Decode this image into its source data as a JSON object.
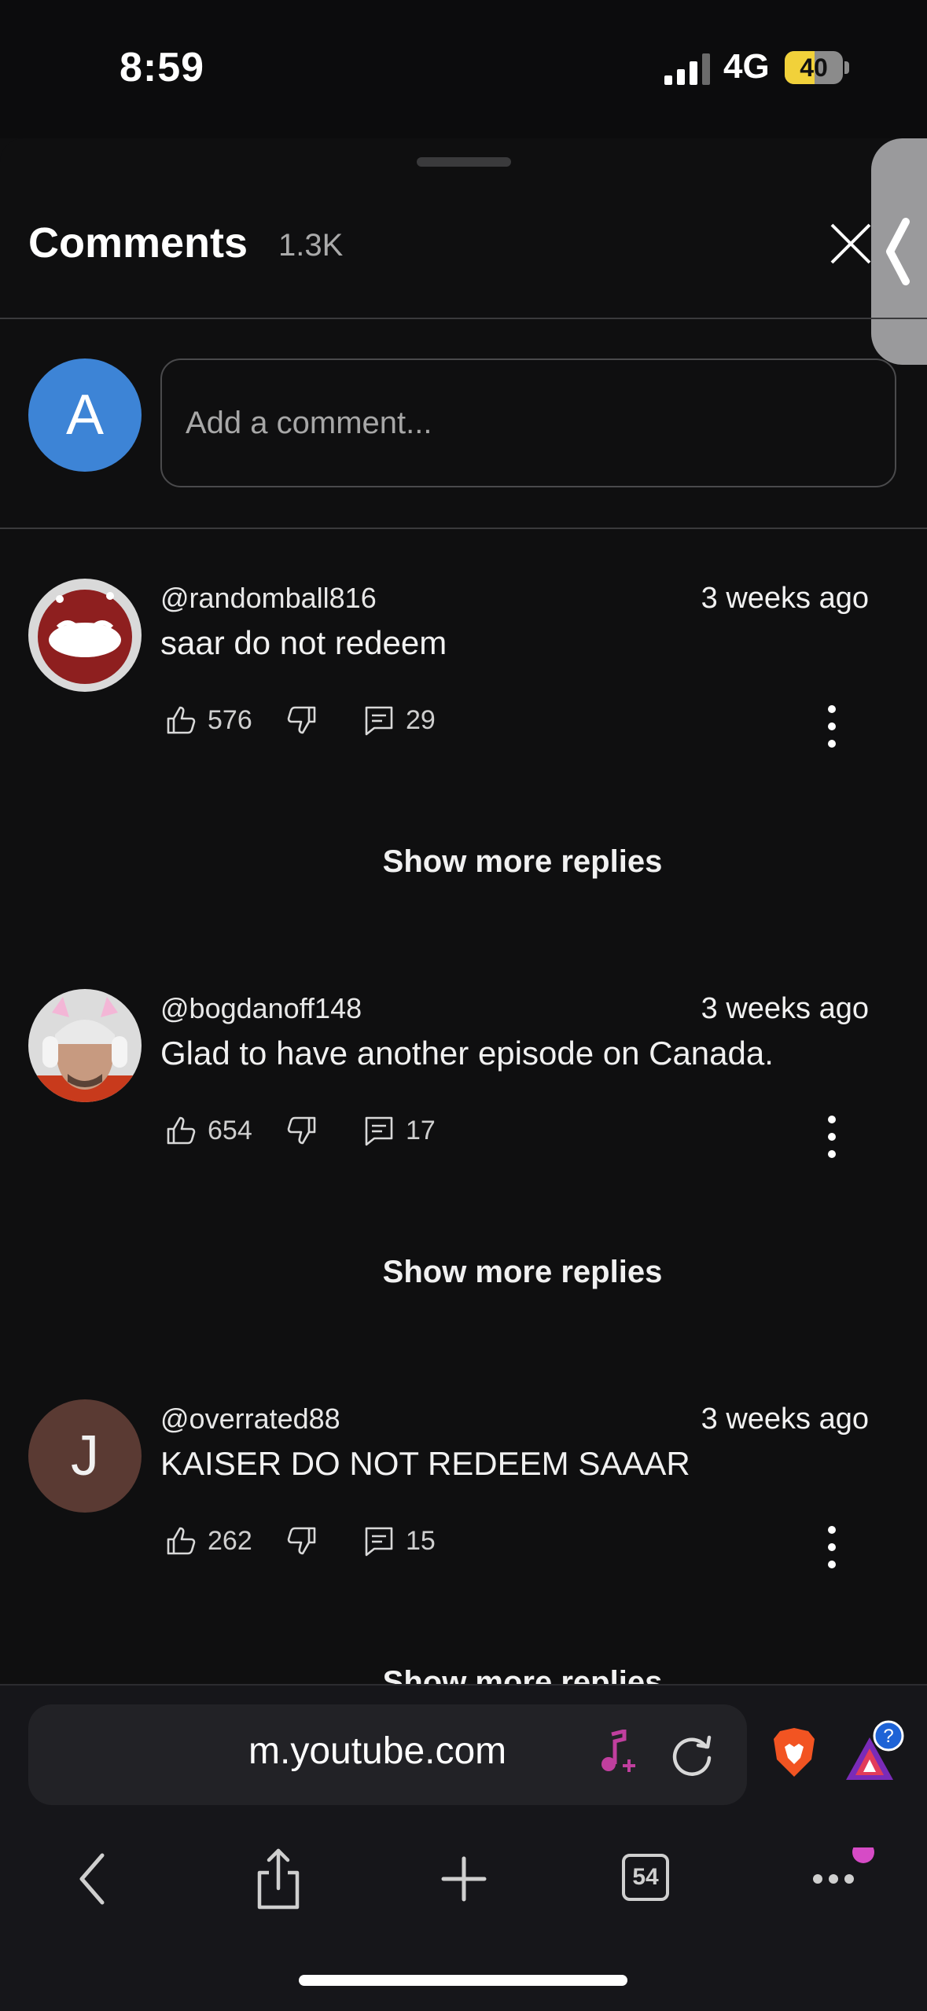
{
  "status_bar": {
    "time": "8:59",
    "network": "4G",
    "battery": "40",
    "battery_level_percent": 40
  },
  "sheet": {
    "title": "Comments",
    "count": "1.3K"
  },
  "composer": {
    "avatar_letter": "A",
    "placeholder": "Add a comment..."
  },
  "comments": [
    {
      "author": "@randomball816",
      "time": "3 weeks ago",
      "text": "saar do not redeem",
      "likes": "576",
      "replies": "29",
      "show_more": "Show more replies"
    },
    {
      "author": "@bogdanoff148",
      "time": "3 weeks ago",
      "text": "Glad to have another episode on Canada.",
      "likes": "654",
      "replies": "17",
      "show_more": "Show more replies"
    },
    {
      "author": "@overrated88",
      "time": "3 weeks ago",
      "text": "KAISER DO NOT REDEEM SAAAR",
      "likes": "262",
      "replies": "15",
      "avatar_letter": "J",
      "show_more": "Show more replies"
    }
  ],
  "browser": {
    "url": "m.youtube.com",
    "tab_count": "54"
  },
  "colors": {
    "background": "#0f0f10",
    "composer_avatar": "#3d84d6",
    "comment3_avatar": "#5a3a33",
    "battery_fill": "#f1d13a"
  }
}
